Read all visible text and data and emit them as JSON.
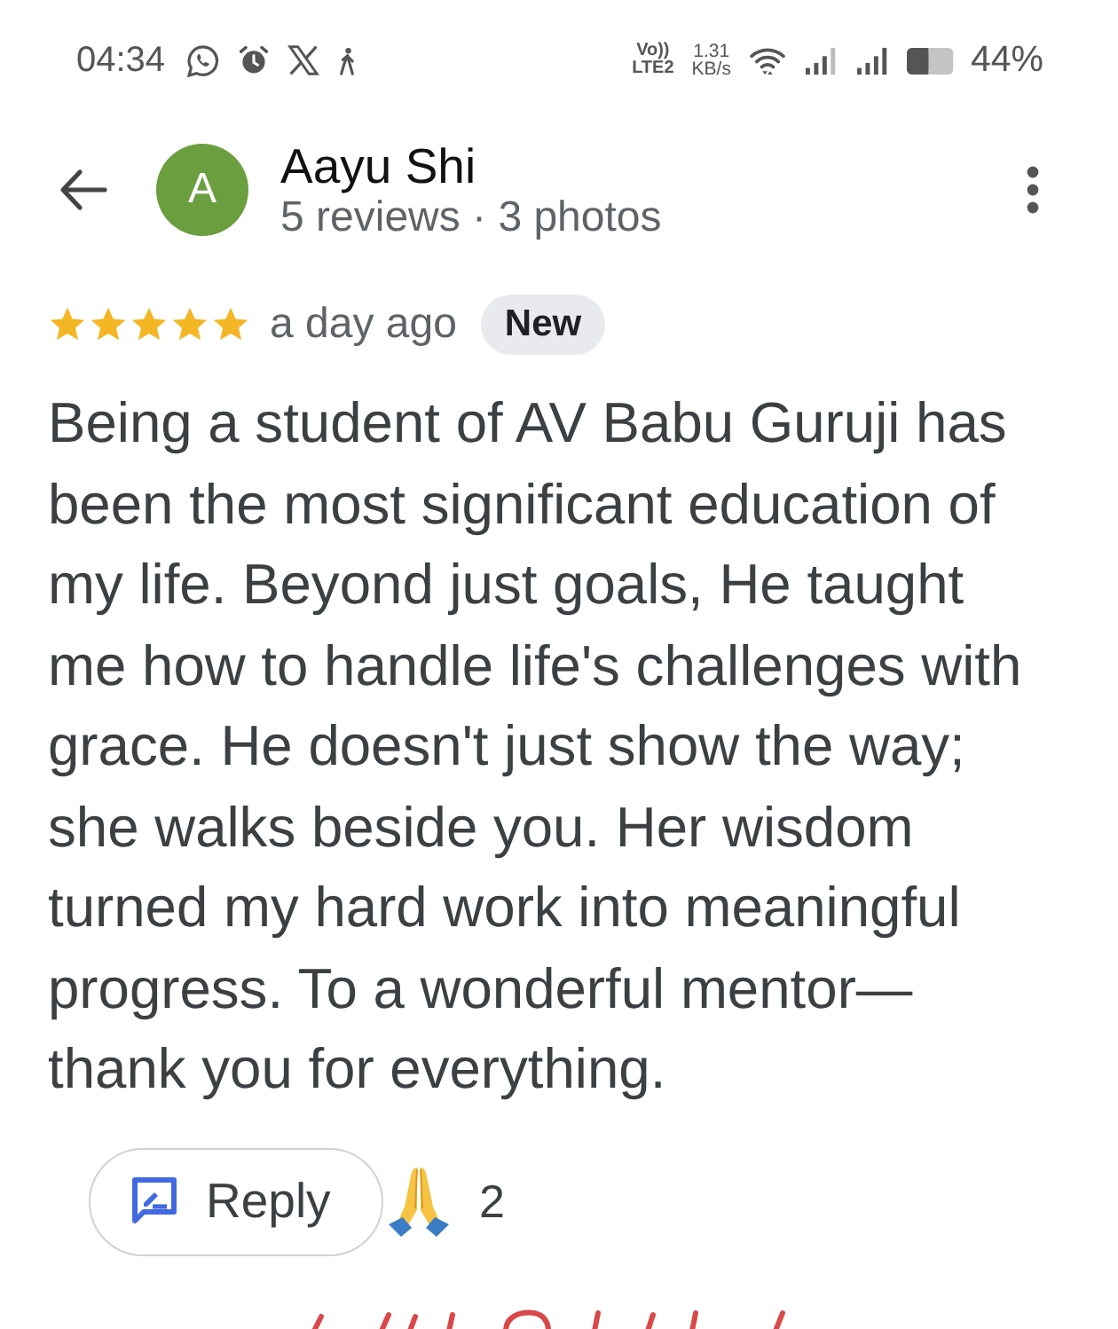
{
  "status_bar": {
    "time": "04:34",
    "volte": [
      "Vo))",
      "LTE2"
    ],
    "speed": [
      "1.31",
      "KB/s"
    ],
    "battery_percent": "44%"
  },
  "header": {
    "avatar_letter": "A",
    "name": "Aayu Shi",
    "subtitle": "5 reviews · 3 photos"
  },
  "review": {
    "stars": 5,
    "time": "a day ago",
    "badge": "New",
    "text": "Being a student of AV Babu Guruji has been the most significant education of my life. Beyond just goals, He taught me how to handle life's challenges with grace. He doesn't just show the way; she walks beside you. Her wisdom turned my hard work into meaningful progress. To a wonderful mentor—thank you for everything."
  },
  "actions": {
    "reply": "Reply",
    "reaction_count": "2"
  }
}
